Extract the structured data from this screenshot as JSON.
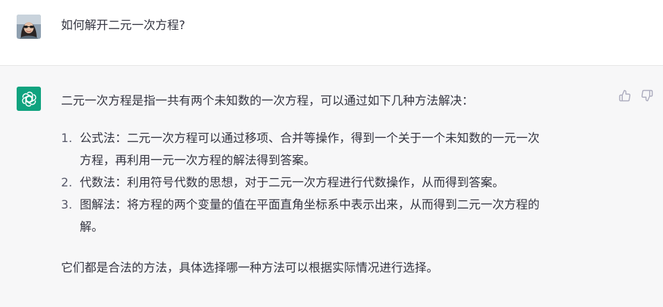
{
  "user": {
    "question": "如何解开二元一次方程?"
  },
  "assistant": {
    "intro": "二元一次方程是指一共有两个未知数的一次方程，可以通过如下几种方法解决：",
    "methods": [
      {
        "number": "1.",
        "line1": "公式法：二元一次方程可以通过移项、合并等操作，得到一个关于一个未知数的一元一次",
        "line2": "方程，再利用一元一次方程的解法得到答案。"
      },
      {
        "number": "2.",
        "line1": "代数法：利用符号代数的思想，对于二元一次方程进行代数操作，从而得到答案。",
        "line2": ""
      },
      {
        "number": "3.",
        "line1": "图解法：将方程的两个变量的值在平面直角坐标系中表示出来，从而得到二元一次方程的",
        "line2": "解。"
      }
    ],
    "closing": "它们都是合法的方法，具体选择哪一种方法可以根据实际情况进行选择。"
  },
  "icons": {
    "user_avatar": "user-avatar-photo",
    "assistant_logo": "openai-logo-icon",
    "thumbs_up": "thumbs-up-icon",
    "thumbs_down": "thumbs-down-icon"
  },
  "colors": {
    "assistant_bg": "#f7f7f8",
    "logo_green": "#10a37f",
    "text": "#343541",
    "icon_gray": "#acacbe"
  }
}
